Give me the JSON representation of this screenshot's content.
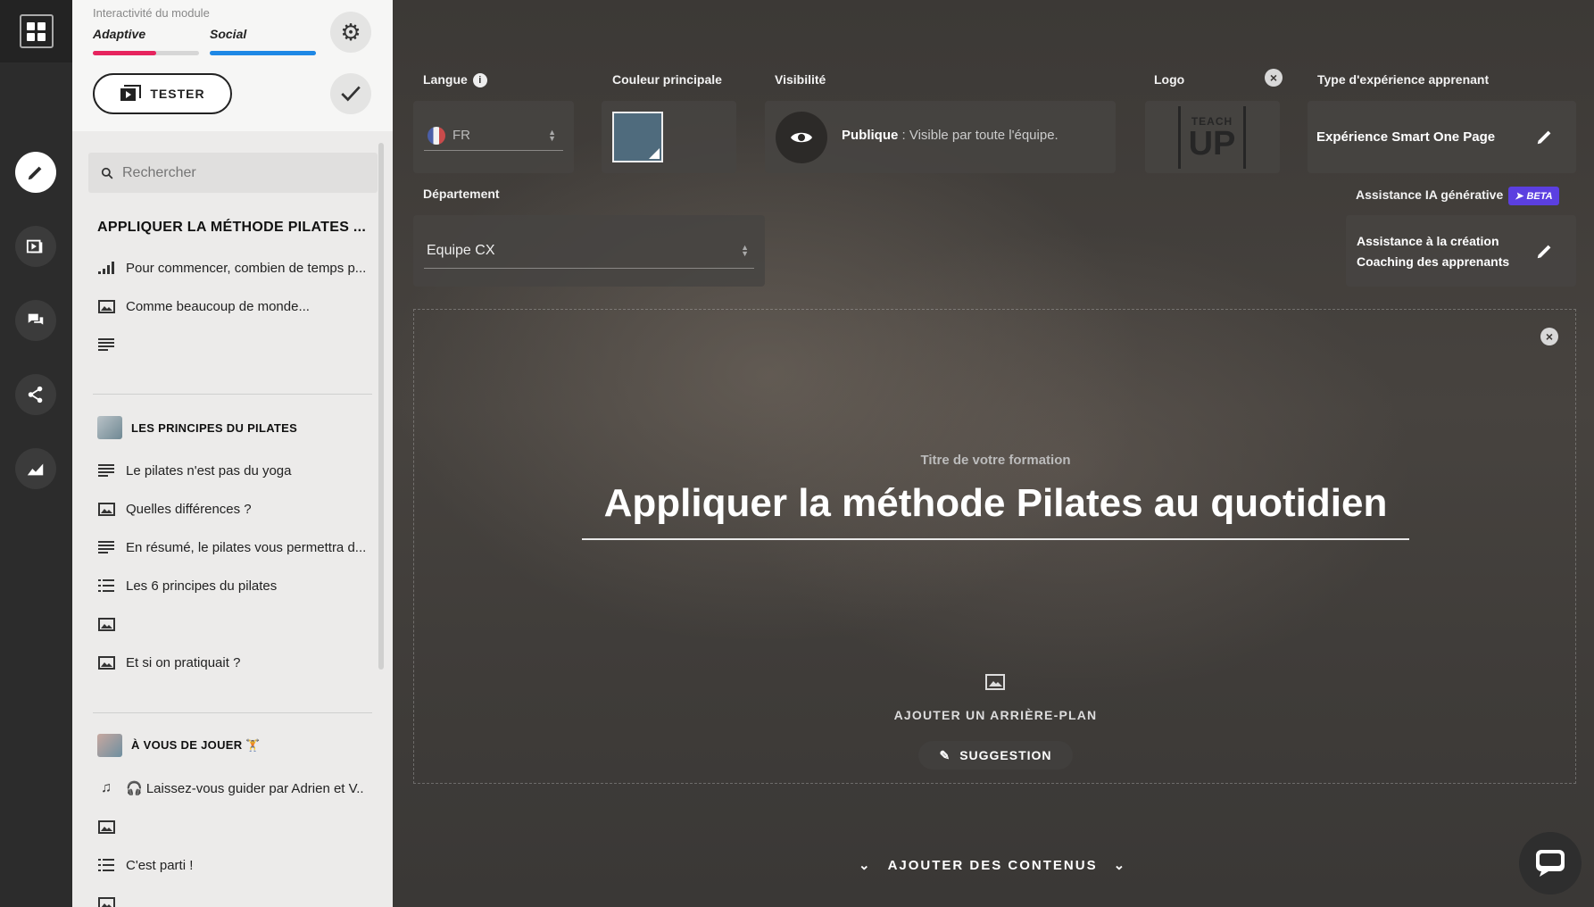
{
  "rail": {
    "items": [
      {
        "name": "edit",
        "icon": "pencil-icon"
      },
      {
        "name": "media",
        "icon": "play-slides-icon"
      },
      {
        "name": "social",
        "icon": "chat-bubbles-icon"
      },
      {
        "name": "share",
        "icon": "share-nodes-icon"
      },
      {
        "name": "stats",
        "icon": "chart-area-icon"
      }
    ]
  },
  "module": {
    "interactivity_label": "Interactivité du module",
    "modes": [
      {
        "label": "Adaptive",
        "level": 0.6,
        "color": "#e6245e"
      },
      {
        "label": "Social",
        "level": 1.0,
        "color": "#1e88e5"
      }
    ],
    "tester_label": "TESTER"
  },
  "search": {
    "placeholder": "Rechercher"
  },
  "outline": {
    "title": "APPLIQUER LA MÉTHODE PILATES ...",
    "intro_items": [
      {
        "icon": "signal-bars-icon",
        "label": "Pour commencer, combien de temps p..."
      },
      {
        "icon": "image-icon",
        "label": "Comme beaucoup de monde..."
      },
      {
        "icon": "text-lines-icon",
        "label": ""
      }
    ],
    "chapters": [
      {
        "title": "LES PRINCIPES DU PILATES",
        "items": [
          {
            "icon": "text-lines-icon",
            "label": "Le pilates n'est pas du yoga"
          },
          {
            "icon": "image-icon",
            "label": "Quelles différences ?"
          },
          {
            "icon": "text-lines-icon",
            "label": "En résumé, le pilates vous permettra d..."
          },
          {
            "icon": "numbered-list-icon",
            "label": "Les 6 principes du pilates"
          },
          {
            "icon": "image-icon",
            "label": ""
          },
          {
            "icon": "image-icon",
            "label": "Et si on pratiquait ?"
          }
        ]
      },
      {
        "title": "À VOUS DE JOUER 🏋",
        "items": [
          {
            "icon": "music-note-icon",
            "label": "🎧 Laissez-vous guider par Adrien et V..."
          },
          {
            "icon": "image-icon",
            "label": ""
          },
          {
            "icon": "numbered-list-icon",
            "label": "C'est parti !"
          },
          {
            "icon": "image-icon",
            "label": ""
          }
        ]
      }
    ]
  },
  "settings": {
    "langue_label": "Langue",
    "langue_value": "FR",
    "couleur_label": "Couleur principale",
    "couleur_value": "#4f6b7d",
    "visibilite_label": "Visibilité",
    "visibilite_value": "Publique",
    "visibilite_desc": " : Visible par toute l'équipe.",
    "logo_label": "Logo",
    "logo_text_top": "TEACH",
    "logo_text_bottom": "UP",
    "type_label": "Type d'expérience apprenant",
    "type_value": "Expérience Smart One Page",
    "departement_label": "Département",
    "departement_value": "Equipe CX",
    "ia_label": "Assistance IA générative",
    "ia_badge": "BETA",
    "ia_line1": "Assistance à la création",
    "ia_line2": "Coaching des apprenants"
  },
  "hero": {
    "subtitle": "Titre de votre formation",
    "title": "Appliquer la méthode Pilates au quotidien",
    "add_background": "AJOUTER UN ARRIÈRE-PLAN",
    "suggestion": "SUGGESTION"
  },
  "footer": {
    "add_content": "AJOUTER DES CONTENUS"
  }
}
